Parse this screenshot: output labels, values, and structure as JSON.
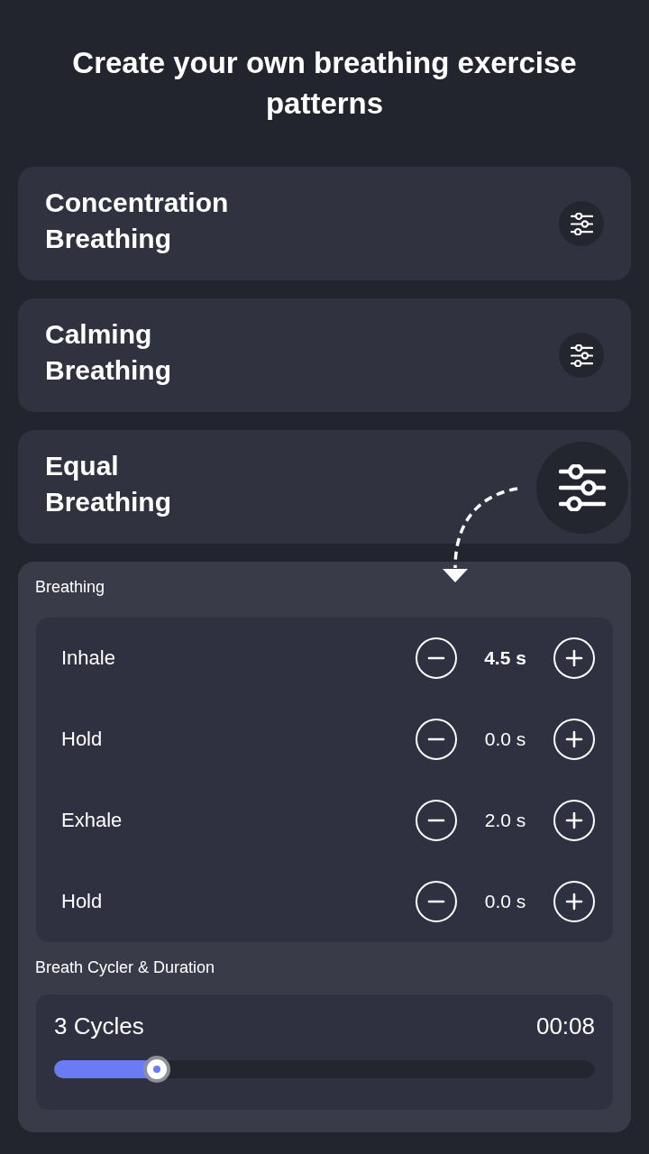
{
  "header": {
    "title": "Create your own breathing exercise patterns"
  },
  "patterns": [
    {
      "name": "Concentration Breathing",
      "expanded": false
    },
    {
      "name": "Calming Breathing",
      "expanded": false
    },
    {
      "name": "Equal Breathing",
      "expanded": true
    }
  ],
  "editor": {
    "breathing": {
      "label": "Breathing",
      "phases": [
        {
          "name": "Inhale",
          "value": "4.5 s",
          "selected": true
        },
        {
          "name": "Hold",
          "value": "0.0 s",
          "selected": false
        },
        {
          "name": "Exhale",
          "value": "2.0 s",
          "selected": false
        },
        {
          "name": "Hold",
          "value": "0.0 s",
          "selected": false
        }
      ]
    },
    "cycles": {
      "label": "Breath Cycler & Duration",
      "count": "3 Cycles",
      "duration": "00:08",
      "level": 0.19
    }
  }
}
